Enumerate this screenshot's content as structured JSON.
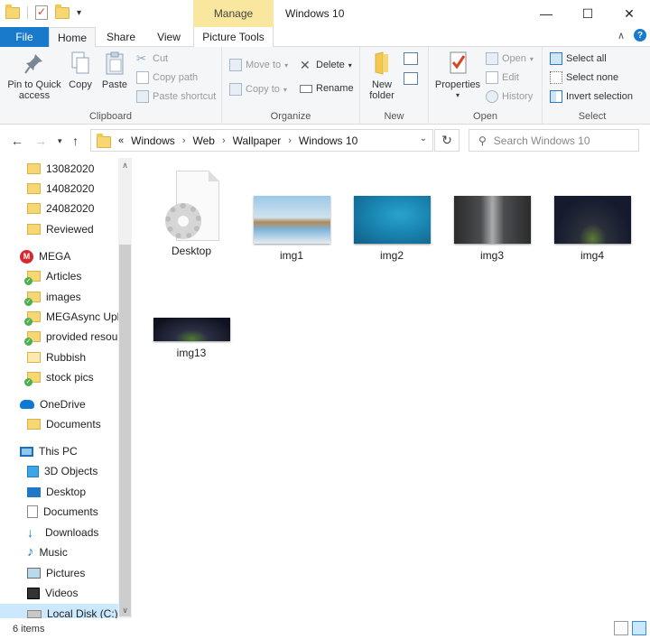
{
  "window": {
    "title": "Windows 10",
    "contextual_tab": "Manage"
  },
  "tabs": {
    "file": "File",
    "home": "Home",
    "share": "Share",
    "view": "View",
    "picture_tools": "Picture Tools"
  },
  "ribbon": {
    "clipboard": {
      "label": "Clipboard",
      "pin": "Pin to Quick access",
      "copy": "Copy",
      "paste": "Paste",
      "cut": "Cut",
      "copy_path": "Copy path",
      "paste_shortcut": "Paste shortcut"
    },
    "organize": {
      "label": "Organize",
      "move_to": "Move to",
      "copy_to": "Copy to",
      "delete": "Delete",
      "rename": "Rename"
    },
    "new": {
      "label": "New",
      "new_folder": "New folder"
    },
    "open": {
      "label": "Open",
      "properties": "Properties",
      "open": "Open",
      "edit": "Edit",
      "history": "History"
    },
    "select": {
      "label": "Select",
      "select_all": "Select all",
      "select_none": "Select none",
      "invert": "Invert selection"
    }
  },
  "address": {
    "overflow": "«",
    "crumbs": [
      "Windows",
      "Web",
      "Wallpaper",
      "Windows 10"
    ],
    "search_placeholder": "Search Windows 10"
  },
  "nav": {
    "items": [
      {
        "label": "13082020",
        "icon": "folder-icon"
      },
      {
        "label": "14082020",
        "icon": "folder-icon"
      },
      {
        "label": "24082020",
        "icon": "folder-icon"
      },
      {
        "label": "Reviewed",
        "icon": "folder-icon"
      },
      {
        "label": "MEGA",
        "icon": "mega-icon"
      },
      {
        "label": "Articles",
        "icon": "folder-sync-icon"
      },
      {
        "label": "images",
        "icon": "folder-sync-icon"
      },
      {
        "label": "MEGAsync Uplo",
        "icon": "folder-sync-icon"
      },
      {
        "label": "provided resourc",
        "icon": "folder-sync-icon"
      },
      {
        "label": "Rubbish",
        "icon": "folder-icon"
      },
      {
        "label": "stock pics",
        "icon": "folder-sync-icon"
      },
      {
        "label": "OneDrive",
        "icon": "onedrive-icon"
      },
      {
        "label": "Documents",
        "icon": "folder-icon"
      },
      {
        "label": "This PC",
        "icon": "pc-icon"
      },
      {
        "label": "3D Objects",
        "icon": "3d-objects-icon"
      },
      {
        "label": "Desktop",
        "icon": "desktop-icon"
      },
      {
        "label": "Documents",
        "icon": "documents-icon"
      },
      {
        "label": "Downloads",
        "icon": "downloads-icon"
      },
      {
        "label": "Music",
        "icon": "music-icon"
      },
      {
        "label": "Pictures",
        "icon": "pictures-icon"
      },
      {
        "label": "Videos",
        "icon": "videos-icon"
      },
      {
        "label": "Local Disk (C:)",
        "icon": "disk-icon"
      }
    ]
  },
  "files": [
    {
      "name": "Desktop",
      "icon": "ini-file-icon"
    },
    {
      "name": "img1",
      "icon": "image-thumbnail",
      "colors": [
        "#7fb3d8",
        "#cfe3ef",
        "#a07a4a"
      ]
    },
    {
      "name": "img2",
      "icon": "image-thumbnail",
      "colors": [
        "#0f5f86",
        "#1b88b5",
        "#2aa3cc"
      ]
    },
    {
      "name": "img3",
      "icon": "image-thumbnail",
      "colors": [
        "#3b3d40",
        "#8a8c8e",
        "#2a2b2d"
      ]
    },
    {
      "name": "img4",
      "icon": "image-thumbnail",
      "colors": [
        "#151a2e",
        "#3a3550",
        "#5c7a3a"
      ]
    },
    {
      "name": "img13",
      "icon": "image-thumbnail",
      "colors": [
        "#10131f",
        "#2c2f45",
        "#4e7c2e"
      ]
    }
  ],
  "status": {
    "count": "6 items"
  }
}
